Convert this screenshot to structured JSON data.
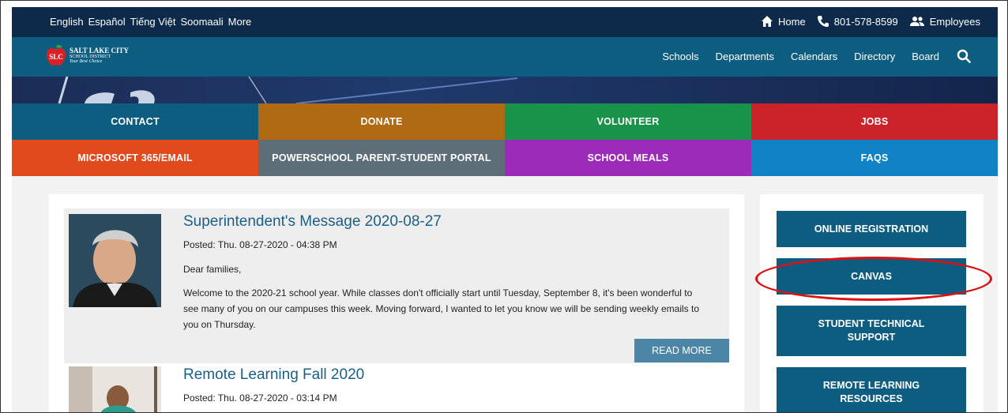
{
  "topbar": {
    "languages": [
      "English",
      "Español",
      "Tiếng Việt",
      "Soomaali",
      "More"
    ],
    "home_label": "Home",
    "phone": "801-578-8599",
    "employees_label": "Employees"
  },
  "logo": {
    "line1": "SALT LAKE CITY",
    "line2": "SCHOOL DISTRICT",
    "line3": "Your Best Choice"
  },
  "nav": {
    "items": [
      "Schools",
      "Departments",
      "Calendars",
      "Directory",
      "Board"
    ]
  },
  "tiles": [
    {
      "label": "CONTACT",
      "color": "#0d5d80"
    },
    {
      "label": "DONATE",
      "color": "#b06a13"
    },
    {
      "label": "VOLUNTEER",
      "color": "#19924a"
    },
    {
      "label": "JOBS",
      "color": "#cc2229"
    },
    {
      "label": "MICROSOFT 365/EMAIL",
      "color": "#e04a1c"
    },
    {
      "label": "POWERSCHOOL PARENT-STUDENT PORTAL",
      "color": "#5e6e78"
    },
    {
      "label": "SCHOOL MEALS",
      "color": "#9b2bb8"
    },
    {
      "label": "FAQS",
      "color": "#1282c7"
    }
  ],
  "posts": [
    {
      "title": "Superintendent's Message 2020-08-27",
      "date": "Posted: Thu. 08-27-2020 - 04:38 PM",
      "greeting": "Dear families,",
      "line1": "Welcome to the 2020-21 school year. While classes don't officially start until Tuesday, September 8, it's been wonderful to",
      "line2": "see many of you on our campuses this week. Moving forward, I wanted to let you know we will be sending weekly emails to",
      "line3": "you on Thursday.",
      "read_more": "READ MORE"
    },
    {
      "title": "Remote Learning Fall 2020",
      "date": "Posted: Thu. 08-27-2020 - 03:14 PM"
    }
  ],
  "sidebar": {
    "buttons": [
      {
        "line1": "ONLINE REGISTRATION",
        "line2": ""
      },
      {
        "line1": "CANVAS",
        "line2": ""
      },
      {
        "line1": "STUDENT TECHNICAL",
        "line2": "SUPPORT"
      },
      {
        "line1": "REMOTE LEARNING",
        "line2": "RESOURCES"
      }
    ]
  },
  "colors": {
    "topbar": "#0d2a4a",
    "navbar": "#0d5d80",
    "title_link": "#1b5f87",
    "annotation": "#dd1111"
  },
  "icons": [
    "home-icon",
    "phone-icon",
    "people-icon",
    "search-icon",
    "apple-logo-icon"
  ]
}
